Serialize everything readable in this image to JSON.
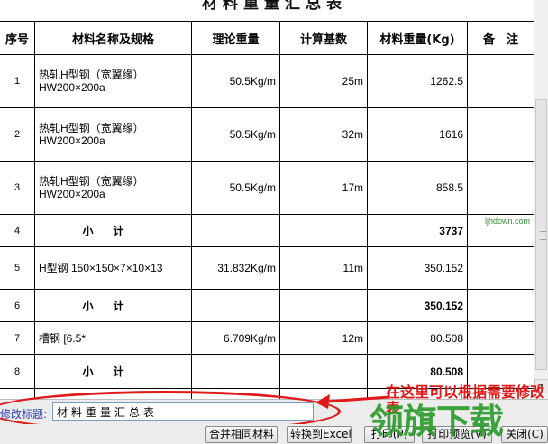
{
  "report_title": "材料重量汇总表",
  "table": {
    "headers": [
      "序号",
      "材料名称及规格",
      "理论重量",
      "计算基数",
      "材料重量(Kg)",
      "备　注"
    ],
    "rows": [
      {
        "idx": "1",
        "name": "热轧H型钢（宽翼缘） HW200×200a",
        "theory": "50.5Kg/m",
        "base": "25m",
        "weight": "1262.5",
        "note": "",
        "subtotal": false
      },
      {
        "idx": "2",
        "name": "热轧H型钢（宽翼缘） HW200×200a",
        "theory": "50.5Kg/m",
        "base": "32m",
        "weight": "1616",
        "note": "",
        "subtotal": false
      },
      {
        "idx": "3",
        "name": "热轧H型钢（宽翼缘） HW200×200a",
        "theory": "50.5Kg/m",
        "base": "17m",
        "weight": "858.5",
        "note": "",
        "subtotal": false
      },
      {
        "idx": "4",
        "name": "小计",
        "theory": "",
        "base": "",
        "weight": "3737",
        "note": "",
        "subtotal": true
      },
      {
        "idx": "5",
        "name": "H型钢 150×150×7×10×13",
        "theory": "31.832Kg/m",
        "base": "11m",
        "weight": "350.152",
        "note": "",
        "subtotal": false
      },
      {
        "idx": "6",
        "name": "小计",
        "theory": "",
        "base": "",
        "weight": "350.152",
        "note": "",
        "subtotal": true
      },
      {
        "idx": "7",
        "name": "槽钢 [6.5*",
        "theory": "6.709Kg/m",
        "base": "12m",
        "weight": "80.508",
        "note": "",
        "subtotal": false
      },
      {
        "idx": "8",
        "name": "小计",
        "theory": "",
        "base": "",
        "weight": "80.508",
        "note": "",
        "subtotal": true
      }
    ]
  },
  "edit": {
    "label": "修改标题:",
    "value": "材料重量汇总表"
  },
  "annotation": "在这里可以根据需要修改表",
  "buttons": {
    "merge": "合并相同材料",
    "excel": "转换到Excel",
    "print": "打印(P)",
    "preview": "打印预览(V)",
    "close": "关闭(C)"
  },
  "watermark": {
    "text": "领旗下载",
    "url": "ljhdown.com"
  },
  "colors": {
    "highlight_red": "#e01818",
    "label_blue": "#2b3fb5",
    "watermark_green": "#2a9a2a"
  }
}
